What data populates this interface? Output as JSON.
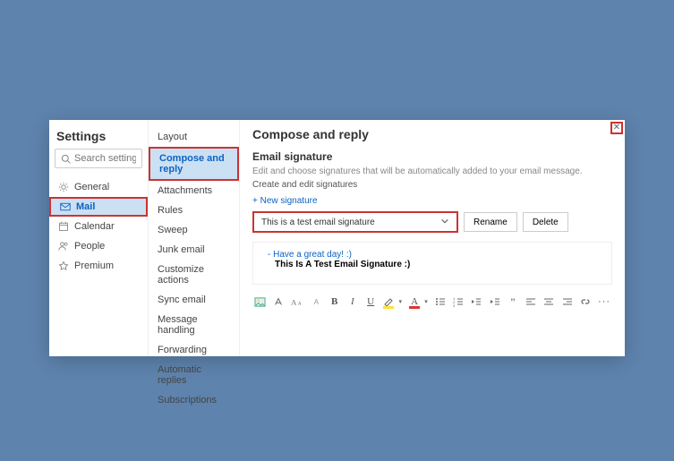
{
  "window": {
    "title": "Settings",
    "closeGlyph": "✕"
  },
  "search": {
    "placeholder": "Search settings"
  },
  "nav": {
    "general": "General",
    "mail": "Mail",
    "calendar": "Calendar",
    "people": "People",
    "premium": "Premium"
  },
  "subnav": {
    "layout": "Layout",
    "compose": "Compose and reply",
    "attachments": "Attachments",
    "rules": "Rules",
    "sweep": "Sweep",
    "junk": "Junk email",
    "customize": "Customize actions",
    "sync": "Sync email",
    "messageHandling": "Message handling",
    "forwarding": "Forwarding",
    "autoReplies": "Automatic replies",
    "subscriptions": "Subscriptions"
  },
  "panel": {
    "title": "Compose and reply",
    "sectionTitle": "Email signature",
    "hint1": "Edit and choose signatures that will be automatically added to your email message.",
    "hint2": "Create and edit signatures",
    "newSig": "+  New signature",
    "selected": "This is a test email signature",
    "rename": "Rename",
    "delete": "Delete",
    "editor": {
      "dash": "- ",
      "line1": "Have a great day! :)",
      "line2": "This Is A Test Email Signature :)"
    }
  },
  "toolbar": {
    "bold": "B",
    "italic": "I",
    "underline": "U",
    "fontColor": "A",
    "more": "···"
  }
}
